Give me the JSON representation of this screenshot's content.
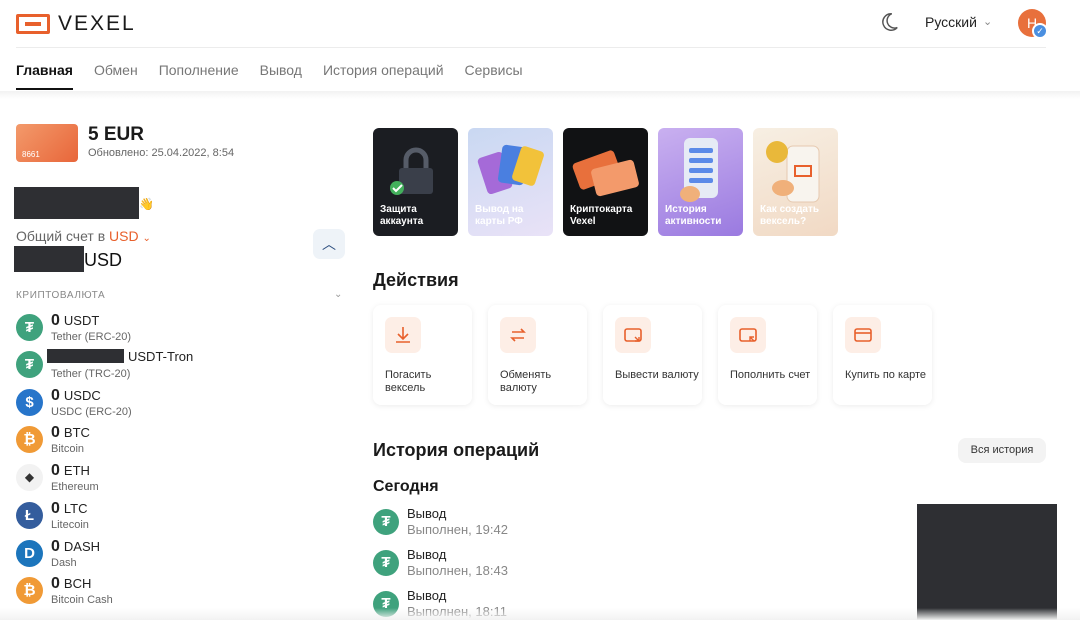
{
  "app": {
    "logo_text": "VEXEL"
  },
  "header": {
    "language": "Русский",
    "avatar_initial": "Н",
    "avatar_badge": "✓"
  },
  "nav": {
    "items": [
      {
        "label": "Главная",
        "active": true
      },
      {
        "label": "Обмен"
      },
      {
        "label": "Пополнение"
      },
      {
        "label": "Вывод"
      },
      {
        "label": "История операций"
      },
      {
        "label": "Сервисы"
      }
    ]
  },
  "balance": {
    "card_number": "8661",
    "amount": "5 EUR",
    "updated": "Обновлено: 25.04.2022, 8:54"
  },
  "account": {
    "greeting_emoji": "👋",
    "label": "Общий счет в",
    "currency": "USD",
    "chevron": "⌄",
    "total_currency": "USD",
    "collapse_icon": "︿"
  },
  "crypto": {
    "section_caption": "КРИПТОВАЛЮТА",
    "section_chevron": "⌄",
    "coins": [
      {
        "amount": "0",
        "symbol": "USDT",
        "network": "Tether (ERC-20)",
        "icon": "tether-icon",
        "color": "#3fa27d",
        "glyph": "₮"
      },
      {
        "amount": "",
        "symbol": "USDT-Tron",
        "network": "Tether (TRC-20)",
        "icon": "tether-icon",
        "color": "#3fa27d",
        "glyph": "₮"
      },
      {
        "amount": "0",
        "symbol": "USDC",
        "network": "USDC (ERC-20)",
        "icon": "usdc-icon",
        "color": "#2775ca",
        "glyph": "$"
      },
      {
        "amount": "0",
        "symbol": "BTC",
        "network": "Bitcoin",
        "icon": "bitcoin-icon",
        "color": "#f09a36",
        "glyph": "₿"
      },
      {
        "amount": "0",
        "symbol": "ETH",
        "network": "Ethereum",
        "icon": "ethereum-icon",
        "color": "#f2f2f2",
        "glyph": "◆"
      },
      {
        "amount": "0",
        "symbol": "LTC",
        "network": "Litecoin",
        "icon": "litecoin-icon",
        "color": "#345d9d",
        "glyph": "Ł"
      },
      {
        "amount": "0",
        "symbol": "DASH",
        "network": "Dash",
        "icon": "dash-icon",
        "color": "#1c75bc",
        "glyph": "D"
      },
      {
        "amount": "0",
        "symbol": "BCH",
        "network": "Bitcoin Cash",
        "icon": "bitcoin-cash-icon",
        "color": "#f09a36",
        "glyph": "₿"
      }
    ]
  },
  "stories": [
    {
      "label": "Защита аккаунта"
    },
    {
      "label": "Вывод на карты РФ"
    },
    {
      "label": "Криптокарта Vexel"
    },
    {
      "label": "История активности"
    },
    {
      "label": "Как создать вексель?"
    }
  ],
  "actions": {
    "title": "Действия",
    "items": [
      {
        "label": "Погасить вексель",
        "icon": "download-icon"
      },
      {
        "label": "Обменять валюту",
        "icon": "exchange-icon"
      },
      {
        "label": "Вывести валюту",
        "icon": "wallet-out-icon"
      },
      {
        "label": "Пополнить счет",
        "icon": "wallet-in-icon"
      },
      {
        "label": "Купить по карте",
        "icon": "card-icon"
      }
    ]
  },
  "history": {
    "title": "История операций",
    "all_button": "Вся история",
    "today": "Сегодня",
    "ops": [
      {
        "title": "Вывод",
        "status": "Выполнен, 19:42"
      },
      {
        "title": "Вывод",
        "status": "Выполнен, 18:43"
      },
      {
        "title": "Вывод",
        "status": "Выполнен, 18:11"
      }
    ]
  },
  "colors": {
    "accent": "#e8602c",
    "tether": "#3fa27d"
  }
}
